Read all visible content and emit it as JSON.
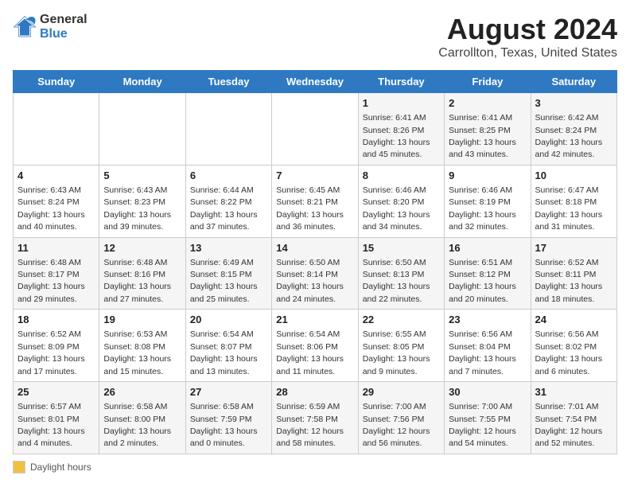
{
  "header": {
    "logo_line1": "General",
    "logo_line2": "Blue",
    "title": "August 2024",
    "subtitle": "Carrollton, Texas, United States"
  },
  "weekdays": [
    "Sunday",
    "Monday",
    "Tuesday",
    "Wednesday",
    "Thursday",
    "Friday",
    "Saturday"
  ],
  "weeks": [
    [
      {
        "day": "",
        "info": ""
      },
      {
        "day": "",
        "info": ""
      },
      {
        "day": "",
        "info": ""
      },
      {
        "day": "",
        "info": ""
      },
      {
        "day": "1",
        "info": "Sunrise: 6:41 AM\nSunset: 8:26 PM\nDaylight: 13 hours\nand 45 minutes."
      },
      {
        "day": "2",
        "info": "Sunrise: 6:41 AM\nSunset: 8:25 PM\nDaylight: 13 hours\nand 43 minutes."
      },
      {
        "day": "3",
        "info": "Sunrise: 6:42 AM\nSunset: 8:24 PM\nDaylight: 13 hours\nand 42 minutes."
      }
    ],
    [
      {
        "day": "4",
        "info": "Sunrise: 6:43 AM\nSunset: 8:24 PM\nDaylight: 13 hours\nand 40 minutes."
      },
      {
        "day": "5",
        "info": "Sunrise: 6:43 AM\nSunset: 8:23 PM\nDaylight: 13 hours\nand 39 minutes."
      },
      {
        "day": "6",
        "info": "Sunrise: 6:44 AM\nSunset: 8:22 PM\nDaylight: 13 hours\nand 37 minutes."
      },
      {
        "day": "7",
        "info": "Sunrise: 6:45 AM\nSunset: 8:21 PM\nDaylight: 13 hours\nand 36 minutes."
      },
      {
        "day": "8",
        "info": "Sunrise: 6:46 AM\nSunset: 8:20 PM\nDaylight: 13 hours\nand 34 minutes."
      },
      {
        "day": "9",
        "info": "Sunrise: 6:46 AM\nSunset: 8:19 PM\nDaylight: 13 hours\nand 32 minutes."
      },
      {
        "day": "10",
        "info": "Sunrise: 6:47 AM\nSunset: 8:18 PM\nDaylight: 13 hours\nand 31 minutes."
      }
    ],
    [
      {
        "day": "11",
        "info": "Sunrise: 6:48 AM\nSunset: 8:17 PM\nDaylight: 13 hours\nand 29 minutes."
      },
      {
        "day": "12",
        "info": "Sunrise: 6:48 AM\nSunset: 8:16 PM\nDaylight: 13 hours\nand 27 minutes."
      },
      {
        "day": "13",
        "info": "Sunrise: 6:49 AM\nSunset: 8:15 PM\nDaylight: 13 hours\nand 25 minutes."
      },
      {
        "day": "14",
        "info": "Sunrise: 6:50 AM\nSunset: 8:14 PM\nDaylight: 13 hours\nand 24 minutes."
      },
      {
        "day": "15",
        "info": "Sunrise: 6:50 AM\nSunset: 8:13 PM\nDaylight: 13 hours\nand 22 minutes."
      },
      {
        "day": "16",
        "info": "Sunrise: 6:51 AM\nSunset: 8:12 PM\nDaylight: 13 hours\nand 20 minutes."
      },
      {
        "day": "17",
        "info": "Sunrise: 6:52 AM\nSunset: 8:11 PM\nDaylight: 13 hours\nand 18 minutes."
      }
    ],
    [
      {
        "day": "18",
        "info": "Sunrise: 6:52 AM\nSunset: 8:09 PM\nDaylight: 13 hours\nand 17 minutes."
      },
      {
        "day": "19",
        "info": "Sunrise: 6:53 AM\nSunset: 8:08 PM\nDaylight: 13 hours\nand 15 minutes."
      },
      {
        "day": "20",
        "info": "Sunrise: 6:54 AM\nSunset: 8:07 PM\nDaylight: 13 hours\nand 13 minutes."
      },
      {
        "day": "21",
        "info": "Sunrise: 6:54 AM\nSunset: 8:06 PM\nDaylight: 13 hours\nand 11 minutes."
      },
      {
        "day": "22",
        "info": "Sunrise: 6:55 AM\nSunset: 8:05 PM\nDaylight: 13 hours\nand 9 minutes."
      },
      {
        "day": "23",
        "info": "Sunrise: 6:56 AM\nSunset: 8:04 PM\nDaylight: 13 hours\nand 7 minutes."
      },
      {
        "day": "24",
        "info": "Sunrise: 6:56 AM\nSunset: 8:02 PM\nDaylight: 13 hours\nand 6 minutes."
      }
    ],
    [
      {
        "day": "25",
        "info": "Sunrise: 6:57 AM\nSunset: 8:01 PM\nDaylight: 13 hours\nand 4 minutes."
      },
      {
        "day": "26",
        "info": "Sunrise: 6:58 AM\nSunset: 8:00 PM\nDaylight: 13 hours\nand 2 minutes."
      },
      {
        "day": "27",
        "info": "Sunrise: 6:58 AM\nSunset: 7:59 PM\nDaylight: 13 hours\nand 0 minutes."
      },
      {
        "day": "28",
        "info": "Sunrise: 6:59 AM\nSunset: 7:58 PM\nDaylight: 12 hours\nand 58 minutes."
      },
      {
        "day": "29",
        "info": "Sunrise: 7:00 AM\nSunset: 7:56 PM\nDaylight: 12 hours\nand 56 minutes."
      },
      {
        "day": "30",
        "info": "Sunrise: 7:00 AM\nSunset: 7:55 PM\nDaylight: 12 hours\nand 54 minutes."
      },
      {
        "day": "31",
        "info": "Sunrise: 7:01 AM\nSunset: 7:54 PM\nDaylight: 12 hours\nand 52 minutes."
      }
    ]
  ],
  "legend": {
    "daylight_label": "Daylight hours"
  }
}
